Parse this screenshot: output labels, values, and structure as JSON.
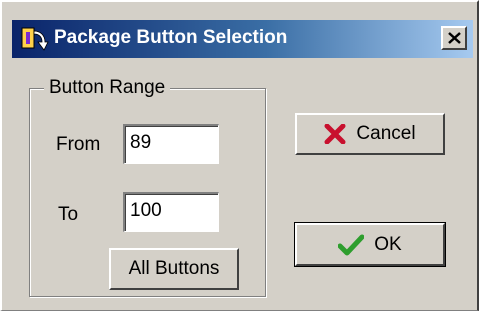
{
  "window": {
    "title": "Package Button Selection",
    "title_icon": "package-icon",
    "close_icon": "close-icon"
  },
  "range_group": {
    "legend": "Button Range",
    "from_label": "From",
    "from_value": "89",
    "to_label": "To",
    "to_value": "100",
    "all_buttons_label": "All Buttons"
  },
  "actions": {
    "cancel_label": "Cancel",
    "cancel_icon": "red-x-icon",
    "ok_label": "OK",
    "ok_icon": "green-check-icon"
  },
  "colors": {
    "title_start": "#0a246a",
    "title_end": "#a6caf0",
    "face": "#d4d0c8",
    "cancel_x": "#c8102e",
    "ok_check": "#2e9e2e"
  }
}
